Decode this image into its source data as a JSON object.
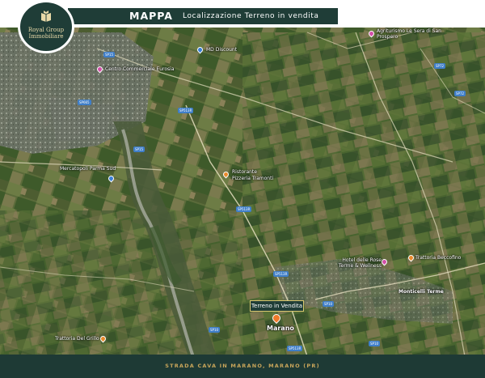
{
  "header": {
    "title": "MAPPA",
    "subtitle": "Localizzazione Terreno in vendita"
  },
  "logo": {
    "line1": "Royal Group",
    "line2": "Immobiliare",
    "icon": "book-crest-icon"
  },
  "map": {
    "places": [
      {
        "name": "Centro Commerciale Eurosia",
        "type": "shopping"
      },
      {
        "name": "MD Discount",
        "type": "shopping"
      },
      {
        "name": "Mercatopoli Parma Sud",
        "type": "shopping"
      },
      {
        "name": "Ristorante Pizzeria Tramonti",
        "type": "restaurant"
      },
      {
        "name": "Agriturismo Le Sera di San Prospero",
        "type": "lodging"
      },
      {
        "name": "Hotel delle Rose Terme & Wellness",
        "type": "lodging"
      },
      {
        "name": "Trattoria Beccofino",
        "type": "restaurant"
      },
      {
        "name": "Monticelli Terme",
        "type": "town"
      },
      {
        "name": "Trattoria Del Grillo",
        "type": "restaurant"
      }
    ],
    "roads": [
      "SP15",
      "SP665",
      "SP513R",
      "SP15",
      "SP513R",
      "SP513R",
      "SP10",
      "SP10",
      "SP513R",
      "SP10",
      "SP72",
      "SP72"
    ],
    "target": {
      "callout": "Terreno in Vendita",
      "locality": "Marano"
    }
  },
  "footer": {
    "address": "STRADA CAVA IN MARANO, MARANO (PR)"
  },
  "colors": {
    "brand_green": "#1f3d37",
    "gold": "#c8a55a",
    "marker_orange": "#f07a2b"
  }
}
